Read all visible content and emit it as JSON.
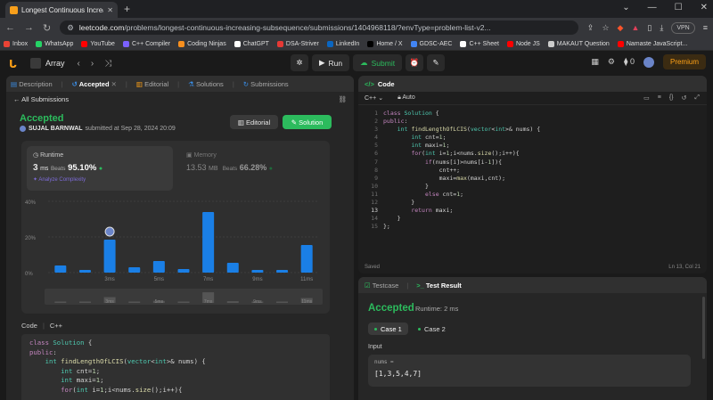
{
  "browser": {
    "tab_title": "Longest Continuous Increasing",
    "url_domain": "leetcode.com",
    "url_path": "/problems/longest-continuous-increasing-subsequence/submissions/1404968118/?envType=problem-list-v2...",
    "vpn": "VPN"
  },
  "bookmarks": [
    {
      "label": "Inbox",
      "color": "#ea4335"
    },
    {
      "label": "WhatsApp",
      "color": "#25d366"
    },
    {
      "label": "YouTube",
      "color": "#ff0000"
    },
    {
      "label": "C++ Compiler",
      "color": "#7b61ff"
    },
    {
      "label": "Coding Ninjas",
      "color": "#f78f1e"
    },
    {
      "label": "ChatGPT",
      "color": "#ffffff"
    },
    {
      "label": "DSA-Striver",
      "color": "#e53935"
    },
    {
      "label": "LinkedIn",
      "color": "#0a66c2"
    },
    {
      "label": "Home / X",
      "color": "#000000"
    },
    {
      "label": "GDSC-AEC",
      "color": "#4285f4"
    },
    {
      "label": "C++ Sheet",
      "color": "#ffffff"
    },
    {
      "label": "Node JS",
      "color": "#ff0000"
    },
    {
      "label": "MAKAUT Question",
      "color": "#cccccc"
    },
    {
      "label": "Namaste JavaScript...",
      "color": "#ff0000"
    }
  ],
  "nav": {
    "problem_list": "Array",
    "run": "Run",
    "submit": "Submit",
    "streak": "0",
    "premium": "Premium"
  },
  "left_tabs": {
    "description": "Description",
    "accepted": "Accepted",
    "editorial": "Editorial",
    "solutions": "Solutions",
    "submissions": "Submissions"
  },
  "submission": {
    "all_submissions": "All Submissions",
    "status": "Accepted",
    "user": "SUJAL BARNWAL",
    "submitted_at": "submitted at Sep 28, 2024 20:09",
    "editorial_btn": "Editorial",
    "solution_btn": "Solution",
    "runtime_label": "Runtime",
    "runtime_value": "3",
    "runtime_unit": "ms",
    "runtime_beats_label": "Beats",
    "runtime_beats": "95.10%",
    "analyze": "Analyze Complexity",
    "memory_label": "Memory",
    "memory_value": "13.53",
    "memory_unit": "MB",
    "memory_beats_label": "Beats",
    "memory_beats": "66.28%",
    "code_label": "Code",
    "lang": "C++"
  },
  "chart_data": {
    "type": "bar",
    "yticks": [
      "40%",
      "20%",
      "0%"
    ],
    "ylim": [
      0,
      40
    ],
    "values": [
      4,
      1.5,
      18.5,
      3,
      6.5,
      2,
      34,
      5.5,
      1.5,
      1.5,
      15.5
    ],
    "xticks": [
      "3ms",
      "5ms",
      "7ms",
      "9ms",
      "11ms"
    ],
    "highlight_index": 2,
    "bar_color": "#1a7fe6"
  },
  "left_code": [
    "class Solution {",
    "public:",
    "    int findLengthOfLCIS(vector<int>& nums) {",
    "        int cnt=1;",
    "        int maxi=1;",
    "        for(int i=1;i<nums.size();i++){"
  ],
  "editor": {
    "tab": "Code",
    "lang": "C++",
    "mode": "Auto",
    "saved": "Saved",
    "position": "Ln 13, Col 21",
    "lines": [
      "class Solution {",
      "public:",
      "    int findLengthOfLCIS(vector<int>& nums) {",
      "        int cnt=1;",
      "        int maxi=1;",
      "        for(int i=1;i<nums.size();i++){",
      "            if(nums[i]>nums[i-1]){",
      "                cnt++;",
      "                maxi=max(maxi,cnt);",
      "            }",
      "            else cnt=1;",
      "        }",
      "        return maxi;",
      "    }",
      "};"
    ]
  },
  "test": {
    "testcase_tab": "Testcase",
    "result_tab": "Test Result",
    "status": "Accepted",
    "runtime": "Runtime: 2 ms",
    "case1": "Case 1",
    "case2": "Case 2",
    "input_label": "Input",
    "var": "nums =",
    "value": "[1,3,5,4,7]"
  }
}
